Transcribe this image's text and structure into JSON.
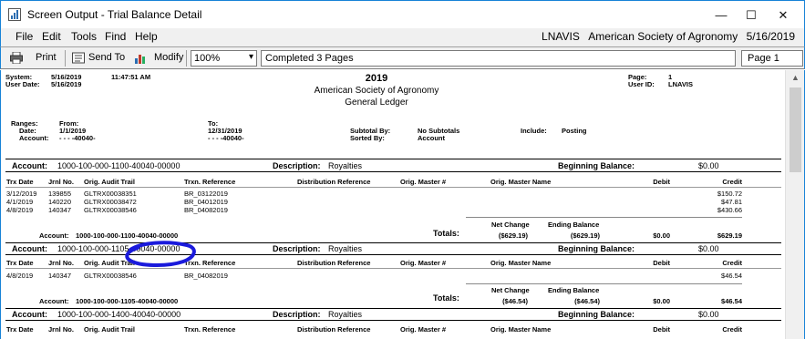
{
  "window": {
    "title": "Screen Output - Trial Balance Detail",
    "minimize": "—",
    "maximize": "☐",
    "close": "✕"
  },
  "menu": {
    "items": [
      "File",
      "Edit",
      "Tools",
      "Find",
      "Help"
    ],
    "status": {
      "user": "LNAVIS",
      "company": "American Society of Agronomy",
      "date": "5/16/2019"
    }
  },
  "toolbar": {
    "print": "Print",
    "send_to": "Send To",
    "modify": "Modify",
    "zoom": "100%",
    "completed": "Completed 3 Pages",
    "page": "Page 1"
  },
  "report": {
    "system_label": "System:",
    "system_date": "5/16/2019",
    "system_time": "11:47:51 AM",
    "user_date_label": "User Date:",
    "user_date": "5/16/2019",
    "year": "2019",
    "org": "American Society of Agronomy",
    "ledger": "General Ledger",
    "page_label": "Page:",
    "page_value": "1",
    "user_id_label": "User ID:",
    "user_id": "LNAVIS",
    "ranges": "Ranges:",
    "from": "From:",
    "to": "To:",
    "date_label": "Date:",
    "account_label": "Account:",
    "from_date": "1/1/2019",
    "from_account": "-   -   -   -40040-",
    "to_date": "12/31/2019",
    "to_account": "-   -   -   -40040-",
    "subtotal_by_label": "Subtotal By:",
    "subtotal_by": "No Subtotals",
    "sorted_by_label": "Sorted By:",
    "sorted_by": "Account",
    "include_label": "Include:",
    "include": "Posting"
  },
  "labels": {
    "account": "Account:",
    "description": "Description:",
    "beginning_balance": "Beginning Balance:",
    "totals": "Totals:",
    "net_change": "Net Change",
    "ending_balance": "Ending Balance"
  },
  "columns": [
    "Trx Date",
    "Jrnl No.",
    "Orig. Audit Trail",
    "Trxn. Reference",
    "Distribution Reference",
    "Orig. Master #",
    "Orig. Master Name",
    "Debit",
    "Credit"
  ],
  "accounts": [
    {
      "account": "1000-100-000-1100-40040-00000",
      "description": "Royalties",
      "beginning_balance": "$0.00",
      "rows": [
        {
          "date": "3/12/2019",
          "jrnl": "139855",
          "audit": "GLTRX00038351",
          "ref": "BR_03122019",
          "credit": "$150.72"
        },
        {
          "date": "4/1/2019",
          "jrnl": "140220",
          "audit": "GLTRX00038472",
          "ref": "BR_04012019",
          "credit": "$47.81"
        },
        {
          "date": "4/8/2019",
          "jrnl": "140347",
          "audit": "GLTRX00038546",
          "ref": "BR_04082019",
          "credit": "$430.66"
        }
      ],
      "footer_account": "1000-100-000-1100-40040-00000",
      "net_change": "($629.19)",
      "ending_balance": "($629.19)",
      "debit_total": "$0.00",
      "credit_total": "$629.19"
    },
    {
      "account": "1000-100-000-1105-40040-00000",
      "description": "Royalties",
      "beginning_balance": "$0.00",
      "rows": [
        {
          "date": "4/8/2019",
          "jrnl": "140347",
          "audit": "GLTRX00038546",
          "ref": "BR_04082019",
          "credit": "$46.54"
        }
      ],
      "footer_account": "1000-100-000-1105-40040-00000",
      "net_change": "($46.54)",
      "ending_balance": "($46.54)",
      "debit_total": "$0.00",
      "credit_total": "$46.54"
    },
    {
      "account": "1000-100-000-1400-40040-00000",
      "description": "Royalties",
      "beginning_balance": "$0.00"
    }
  ]
}
